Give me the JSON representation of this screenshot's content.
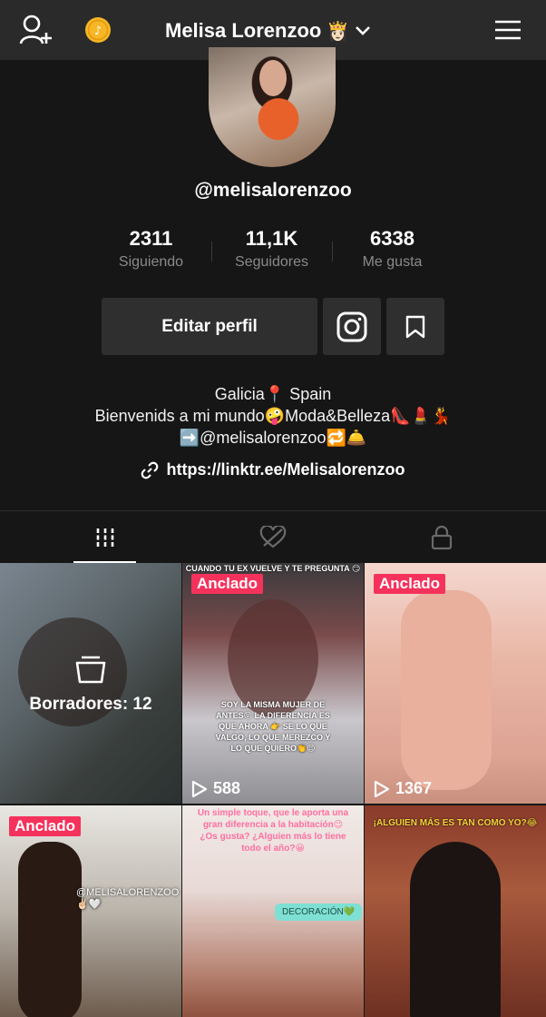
{
  "topbar": {
    "title": "Melisa Lorenzoo",
    "title_emoji": "👸🏻",
    "icons": [
      "add-user-icon",
      "coin-icon",
      "chevron-down-icon",
      "hamburger-menu-icon"
    ]
  },
  "profile": {
    "username": "@melisalorenzoo",
    "stats": [
      {
        "value": "2311",
        "label": "Siguiendo"
      },
      {
        "value": "11,1K",
        "label": "Seguidores"
      },
      {
        "value": "6338",
        "label": "Me gusta"
      }
    ],
    "edit_label": "Editar perfil",
    "bio_lines": [
      "Galicia📍 Spain",
      "Bienvenids a mi mundo🤪Moda&Belleza👠💄💃",
      "➡️@melisalorenzoo🔁🛎️"
    ],
    "link": "https://linktr.ee/Melisalorenzoo"
  },
  "tabs": [
    "grid-icon",
    "liked-hidden-icon",
    "lock-icon"
  ],
  "grid": {
    "drafts_label": "Borradores: 12",
    "pinned_label": "Anclado",
    "items": [
      {
        "plays": "588",
        "caption_top": "CUANDO TU EX VUELVE Y TE PREGUNTA 😏",
        "caption_bottom": "SOY LA MISMA MUJER DE ANTES😝 LA DIFERENCIA ES QUE AHORA 👉 SE LO QUE VALGO, LO QUE MEREZCO Y LO QUE QUIERO👏😉"
      },
      {
        "plays": "1367"
      },
      {
        "caption": "@MELISALORENZOO✌🏻🤍"
      },
      {
        "caption": "Un simple toque, que le aporta una gran diferencia a la habitación😉 ¿Os gusta? ¿Alguien más lo tiene todo el año?😀",
        "tag": "DECORACIÓN💚"
      },
      {
        "caption": "¡ALGUIEN MÁS ES TAN COMO YO?😂"
      }
    ]
  },
  "colors": {
    "background": "#161616",
    "topbar": "#2a2a2a",
    "button": "#2f2f2f",
    "pin": "#f5325c",
    "muted": "#8a8a8a"
  }
}
